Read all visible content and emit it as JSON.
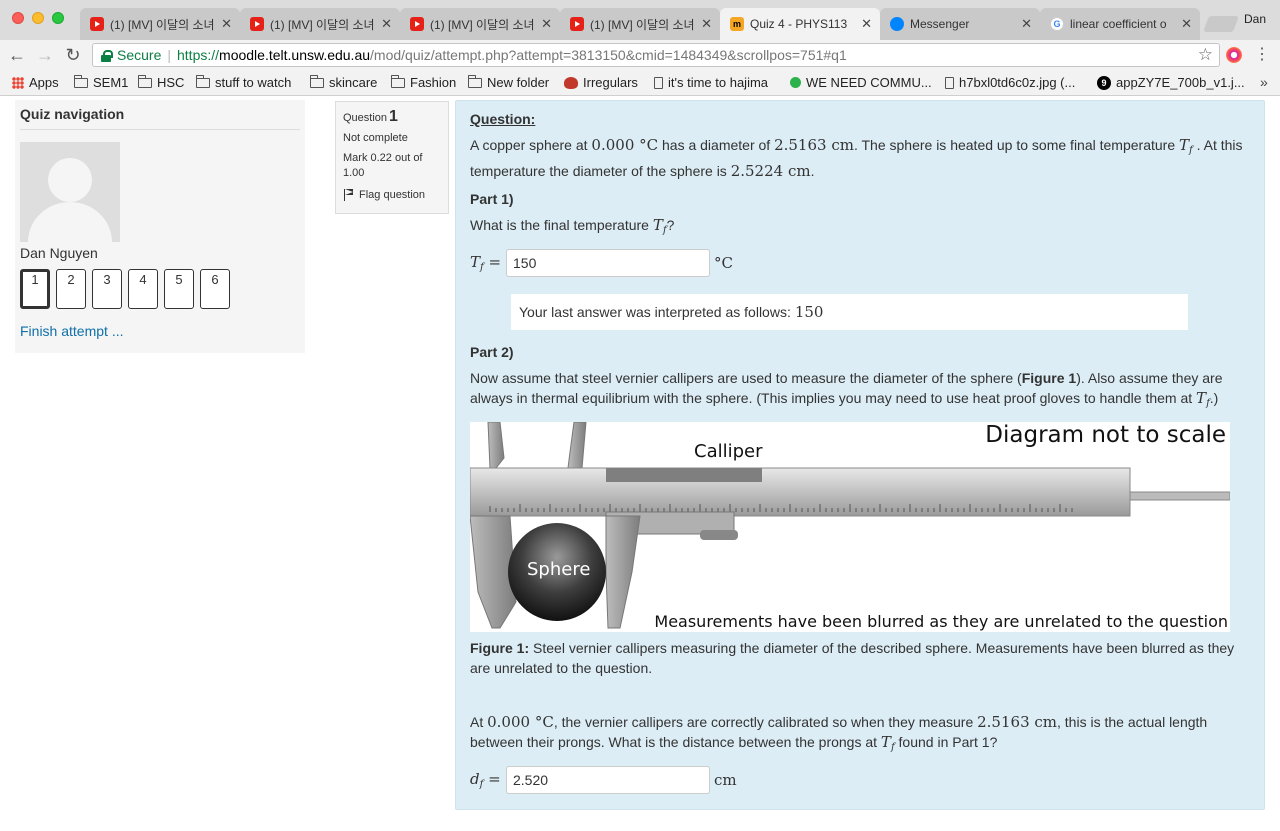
{
  "browser": {
    "tabs": [
      {
        "title": "(1) [MV] 이달의 소녀",
        "icon": "youtube-icon",
        "active": false
      },
      {
        "title": "(1) [MV] 이달의 소녀",
        "icon": "youtube-icon",
        "active": false
      },
      {
        "title": "(1) [MV] 이달의 소녀",
        "icon": "youtube-icon",
        "active": false
      },
      {
        "title": "(1) [MV] 이달의 소녀",
        "icon": "youtube-icon",
        "active": false
      },
      {
        "title": "Quiz 4 - PHYS113",
        "icon": "moodle-icon",
        "active": true
      },
      {
        "title": "Messenger",
        "icon": "messenger-icon",
        "active": false
      },
      {
        "title": "linear coefficient o",
        "icon": "google-icon",
        "active": false
      }
    ],
    "tab_close_glyph": "✕",
    "profile_name": "Dan",
    "url": {
      "secure_label": "Secure",
      "scheme": "https://",
      "host": "moodle.telt.unsw.edu.au",
      "path": "/mod/quiz/attempt.php?attempt=3813150&cmid=1484349&scrollpos=751#q1"
    },
    "bookmarks": [
      {
        "label": "Apps",
        "icon": "apps-grid-icon"
      },
      {
        "label": "SEM1",
        "icon": "folder-icon"
      },
      {
        "label": "HSC",
        "icon": "folder-icon"
      },
      {
        "label": "stuff to watch",
        "icon": "folder-icon"
      },
      {
        "label": "skincare",
        "icon": "folder-icon"
      },
      {
        "label": "Fashion",
        "icon": "folder-icon"
      },
      {
        "label": "New folder",
        "icon": "folder-icon"
      },
      {
        "label": "Irregulars",
        "icon": "crab-icon"
      },
      {
        "label": "it's time to hajima",
        "icon": "page-icon"
      },
      {
        "label": "WE NEED COMMU...",
        "icon": "green-dot-icon"
      },
      {
        "label": "h7bxl0td6c0z.jpg (...",
        "icon": "page-icon"
      },
      {
        "label": "appZY7E_700b_v1.j...",
        "icon": "9gag-icon"
      }
    ],
    "bookmarks_more": "»"
  },
  "quiz_nav": {
    "title": "Quiz navigation",
    "user_name": "Dan Nguyen",
    "questions": [
      "1",
      "2",
      "3",
      "4",
      "5",
      "6"
    ],
    "current_question": "1",
    "finish_label": "Finish attempt ..."
  },
  "question_info": {
    "label": "Question",
    "number": "1",
    "state": "Not complete",
    "grade": "Mark 0.22 out of 1.00",
    "flag_label": "Flag question"
  },
  "question": {
    "heading": "Question:",
    "intro_part1": "A copper sphere at",
    "intro_temp": "0.000 °C",
    "intro_part2": "has a diameter of",
    "intro_diam": "2.5163 cm",
    "intro_part3": ". The sphere is heated up to some final temperature",
    "intro_var": "T",
    "intro_var_sub": "f",
    "intro_part4": ". At this temperature the diameter of the sphere is",
    "intro_diam2": "2.5224 cm",
    "intro_part5": ".",
    "part1": {
      "heading": "Part 1)",
      "prompt_pre": "What is the final temperature",
      "prompt_var": "T",
      "prompt_sub": "f",
      "prompt_post": "?",
      "input_var": "T",
      "input_sub": "f",
      "equals": "=",
      "answer": "150",
      "unit": "°C",
      "interpretation_label": "Your last answer was interpreted as follows:",
      "interpretation_value": "150"
    },
    "part2": {
      "heading": "Part 2)",
      "text_pre": "Now assume that steel vernier callipers are used to measure the diameter of the sphere (",
      "text_fig": "Figure 1",
      "text_mid": "). Also assume they are always in thermal equilibrium with the sphere. (This implies you may need to use heat proof gloves to handle them at",
      "text_var": "T",
      "text_sub": "f",
      "text_post": ".)",
      "figure": {
        "title": "Diagram not to scale",
        "calliper_label": "Calliper",
        "sphere_label": "Sphere",
        "footer": "Measurements have been blurred as they are unrelated to the question",
        "caption_label": "Figure 1:",
        "caption": "Steel vernier callipers measuring the diameter of the described sphere. Measurements have been blurred as they are unrelated to the question."
      },
      "calib_pre": "At",
      "calib_temp": "0.000 °C",
      "calib_mid": ", the vernier callipers are correctly calibrated so when they measure",
      "calib_len": "2.5163 cm",
      "calib_post": ", this is the actual length between their prongs. What is the distance between the prongs at",
      "calib_var": "T",
      "calib_sub": "f",
      "calib_end": "found in Part 1?",
      "input_var": "d",
      "input_sub": "f",
      "equals": "=",
      "answer": "2.520",
      "unit": "cm"
    }
  }
}
